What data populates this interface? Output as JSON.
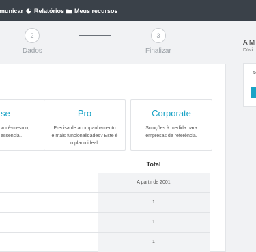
{
  "nav": {
    "items": [
      {
        "label": "municar",
        "icon": ""
      },
      {
        "label": "Relatórios",
        "icon": "pie-chart-icon"
      },
      {
        "label": "Meus recursos",
        "icon": "folder-icon"
      }
    ]
  },
  "stepper": {
    "steps": [
      {
        "number": "2",
        "label": "Dados"
      },
      {
        "number": "3",
        "label": "Finalizar"
      }
    ]
  },
  "plans": [
    {
      "title": "se",
      "desc": [
        "você-mesmo,",
        "essencial."
      ]
    },
    {
      "title": "Pro",
      "desc": [
        "Precisa de acompanhamento",
        "e mais funcionalidades? Este é",
        "o plano ideal."
      ]
    },
    {
      "title": "Corporate",
      "desc": [
        "Soluções à medida para",
        "empresas de referência."
      ]
    }
  ],
  "table": {
    "total_header": "Total",
    "cells": [
      "A partir de 2001",
      "1",
      "1",
      "1"
    ]
  },
  "sidebar": {
    "title": "A M",
    "subtitle": "Dúvi",
    "mark": "5"
  },
  "colors": {
    "topbar": "#3a4149",
    "accent": "#1aa3c6"
  }
}
